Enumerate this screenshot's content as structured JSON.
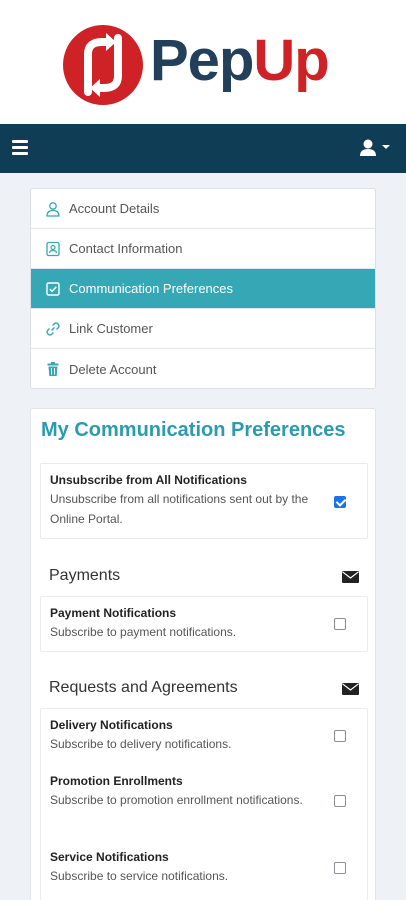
{
  "brand": {
    "name_part1": "Pep",
    "name_part2": "Up",
    "colors": {
      "red": "#cf2227",
      "navy": "#22405a",
      "navbar": "#0e3d55",
      "accent": "#35a7b5",
      "heading": "#2a9cae"
    }
  },
  "navbar": {
    "menu_icon": "hamburger-icon",
    "user_icon": "user-icon",
    "caret_icon": "caret-down-icon"
  },
  "sidebar": {
    "items": [
      {
        "label": "Account Details",
        "icon": "user-outline-icon",
        "active": false
      },
      {
        "label": "Contact Information",
        "icon": "contact-card-icon",
        "active": false
      },
      {
        "label": "Communication Preferences",
        "icon": "checkbox-icon",
        "active": true
      },
      {
        "label": "Link Customer",
        "icon": "link-icon",
        "active": false
      },
      {
        "label": "Delete Account",
        "icon": "trash-icon",
        "active": false
      }
    ]
  },
  "main": {
    "title": "My Communication Preferences",
    "unsubscribe_all": {
      "title": "Unsubscribe from All Notifications",
      "description": "Unsubscribe from all notifications sent out by the Online Portal.",
      "checked": true
    },
    "sections": [
      {
        "label": "Payments",
        "icon": "envelope-icon",
        "items": [
          {
            "title": "Payment Notifications",
            "description": "Subscribe to payment notifications.",
            "checked": false
          }
        ]
      },
      {
        "label": "Requests and Agreements",
        "icon": "envelope-icon",
        "items": [
          {
            "title": "Delivery Notifications",
            "description": "Subscribe to delivery notifications.",
            "checked": false
          },
          {
            "title": "Promotion Enrollments",
            "description": "Subscribe to promotion enrollment notifications.",
            "checked": false
          },
          {
            "title": "Service Notifications",
            "description": "Subscribe to service notifications.",
            "checked": false
          }
        ]
      }
    ]
  }
}
